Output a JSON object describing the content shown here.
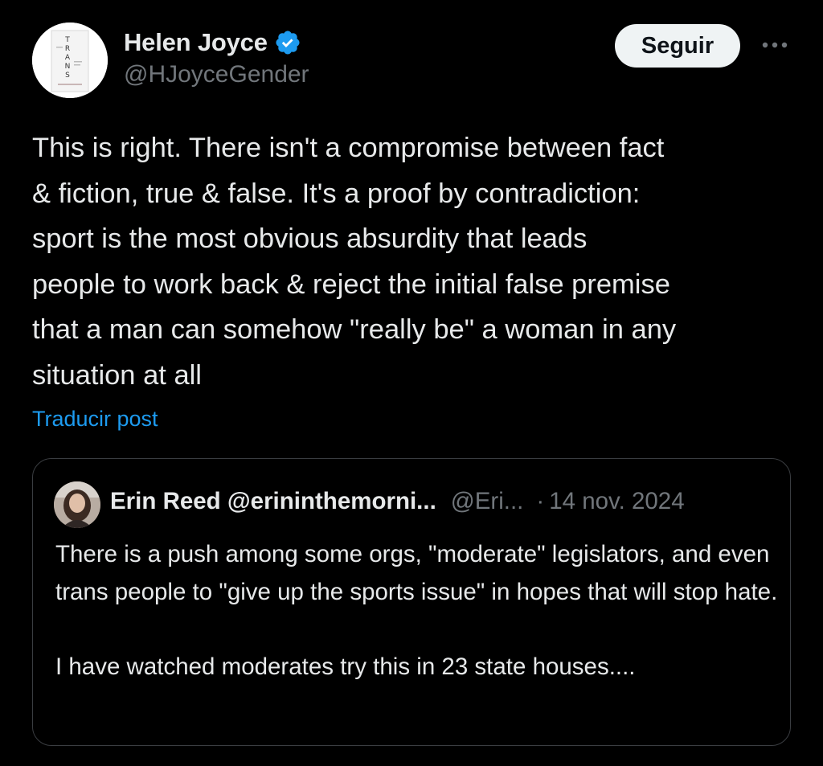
{
  "author": {
    "display_name": "Helen Joyce",
    "handle": "@HJoyceGender",
    "avatar": "book-cover-trans-avatar",
    "avatar_lettering": "TRANS",
    "verified_icon": "verified-badge-icon",
    "verified_color": "#1d9bf0"
  },
  "actions": {
    "follow_label": "Seguir",
    "more_icon": "more-dots-icon"
  },
  "tweet": {
    "text": "This is right. There isn't a compromise between fact\n& fiction, true & false. It's a proof by contradiction:\nsport is the most obvious absurdity that leads\npeople to work back & reject the initial false premise\nthat a man can somehow \"really be\" a woman in any\nsituation at all",
    "translate_label": "Traducir post"
  },
  "quote": {
    "display_name": "Erin Reed @erininthemorni...",
    "handle": "@Eri...",
    "separator": "·",
    "date": "14 nov. 2024",
    "avatar": "erin-reed-avatar",
    "paragraphs": [
      "There is a push among some orgs, \"moderate\" legislators, and even trans people to \"give up the sports issue\" in hopes that will stop hate.",
      "I have watched moderates try this in 23 state houses...."
    ]
  },
  "colors": {
    "background": "#000000",
    "text_primary": "#e7e9ea",
    "text_secondary": "#71767b",
    "link": "#1d9bf0",
    "border": "#3a3d41",
    "button_bg": "#eff3f4"
  }
}
